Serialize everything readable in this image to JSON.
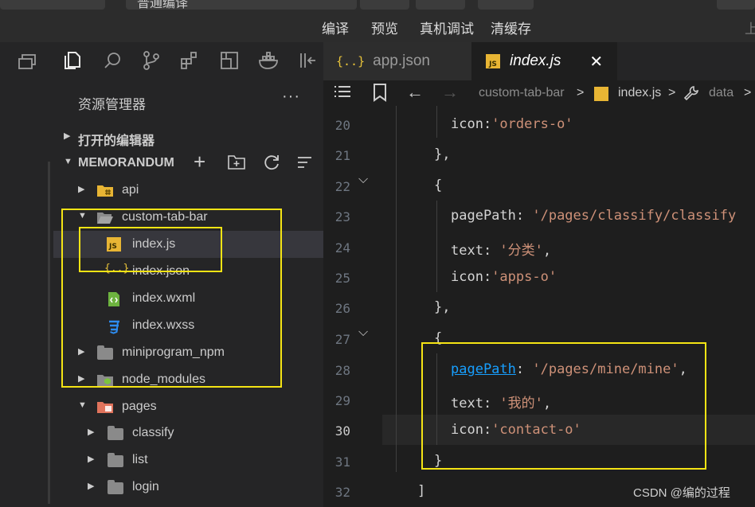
{
  "toolbar": {
    "mode_select": "普通编译",
    "compile": "编译",
    "preview": "预览",
    "device_debug": "真机调试",
    "clear_cache": "清缓存",
    "upload": "上"
  },
  "explorer": {
    "title": "资源管理器",
    "more": "···",
    "open_editors": "打开的编辑器",
    "project": "MEMORANDUM"
  },
  "tree": [
    {
      "label": "api",
      "type": "folder"
    },
    {
      "label": "custom-tab-bar",
      "type": "folder-open"
    },
    {
      "label": "index.js",
      "type": "js"
    },
    {
      "label": "index.json",
      "type": "json"
    },
    {
      "label": "index.wxml",
      "type": "wxml"
    },
    {
      "label": "index.wxss",
      "type": "wxss"
    },
    {
      "label": "miniprogram_npm",
      "type": "folder"
    },
    {
      "label": "node_modules",
      "type": "folder"
    },
    {
      "label": "pages",
      "type": "folder-open"
    },
    {
      "label": "classify",
      "type": "folder"
    },
    {
      "label": "list",
      "type": "folder"
    },
    {
      "label": "login",
      "type": "folder"
    }
  ],
  "tabs": [
    {
      "label": "app.json",
      "icon": "{..}"
    },
    {
      "label": "index.js",
      "icon": "JS"
    }
  ],
  "breadcrumb": {
    "folder": "custom-tab-bar",
    "file": "index.js",
    "symbol": "data"
  },
  "code_lines": [
    {
      "num": "20",
      "parts": [
        [
          "k",
          "icon:"
        ],
        [
          "s",
          "'orders-o'"
        ]
      ]
    },
    {
      "num": "21",
      "parts": [
        [
          "k",
          "},"
        ]
      ]
    },
    {
      "num": "22",
      "parts": [
        [
          "k",
          "{"
        ]
      ]
    },
    {
      "num": "23",
      "parts": [
        [
          "k",
          "pagePath: "
        ],
        [
          "s",
          "'/pages/classify/classify"
        ]
      ]
    },
    {
      "num": "24",
      "parts": [
        [
          "k",
          "text: "
        ],
        [
          "s",
          "'分类'"
        ],
        [
          "k",
          ","
        ]
      ]
    },
    {
      "num": "25",
      "parts": [
        [
          "k",
          "icon:"
        ],
        [
          "s",
          "'apps-o'"
        ]
      ]
    },
    {
      "num": "26",
      "parts": [
        [
          "k",
          "},"
        ]
      ]
    },
    {
      "num": "27",
      "parts": [
        [
          "k",
          "{"
        ]
      ]
    },
    {
      "num": "28",
      "parts": [
        [
          "b",
          "pagePath"
        ],
        [
          "k",
          ": "
        ],
        [
          "s",
          "'/pages/mine/mine'"
        ],
        [
          "k",
          ","
        ]
      ]
    },
    {
      "num": "29",
      "parts": [
        [
          "k",
          "text: "
        ],
        [
          "s",
          "'我的'"
        ],
        [
          "k",
          ","
        ]
      ]
    },
    {
      "num": "30",
      "parts": [
        [
          "k",
          "icon:"
        ],
        [
          "s",
          "'contact-o'"
        ]
      ]
    },
    {
      "num": "31",
      "parts": [
        [
          "k",
          "}"
        ]
      ]
    },
    {
      "num": "32",
      "parts": [
        [
          "k",
          "]"
        ]
      ]
    }
  ],
  "watermark": "CSDN @编的过程"
}
